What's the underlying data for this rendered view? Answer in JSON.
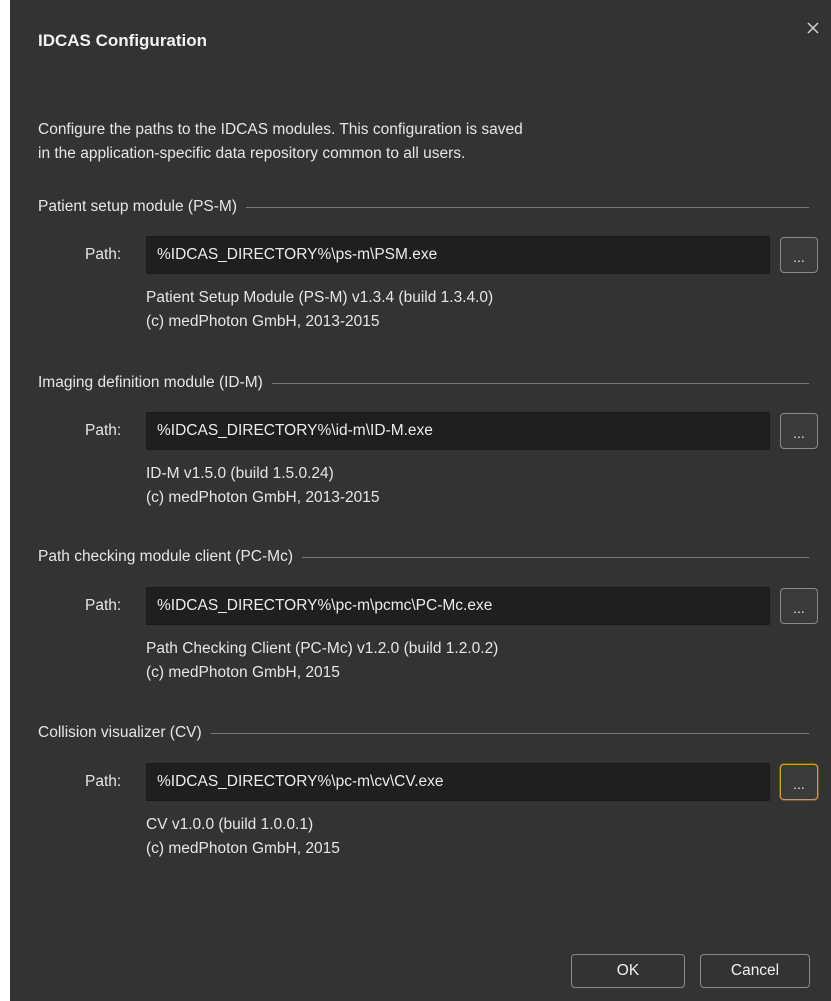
{
  "dialog": {
    "title": "IDCAS Configuration",
    "close_icon": "close-icon",
    "close_glyph": "×",
    "description_line1": "Configure the paths to the IDCAS modules. This configuration is saved",
    "description_line2": "in the application-specific data repository common to all users."
  },
  "modules": [
    {
      "group_title": "Patient setup module (PS-M)",
      "path_label": "Path:",
      "path_value": "%IDCAS_DIRECTORY%\\ps-m\\PSM.exe",
      "browse_label": "...",
      "info_line1": "Patient Setup Module (PS-M) v1.3.4 (build 1.3.4.0)",
      "info_line2": "(c) medPhoton GmbH, 2013-2015"
    },
    {
      "group_title": "Imaging definition module (ID-M)",
      "path_label": "Path:",
      "path_value": "%IDCAS_DIRECTORY%\\id-m\\ID-M.exe",
      "browse_label": "...",
      "info_line1": "ID-M v1.5.0 (build 1.5.0.24)",
      "info_line2": "(c) medPhoton GmbH, 2013-2015"
    },
    {
      "group_title": "Path checking module client (PC-Mc)",
      "path_label": "Path:",
      "path_value": "%IDCAS_DIRECTORY%\\pc-m\\pcmc\\PC-Mc.exe",
      "browse_label": "...",
      "info_line1": "Path Checking Client (PC-Mc) v1.2.0 (build 1.2.0.2)",
      "info_line2": "(c) medPhoton GmbH, 2015"
    },
    {
      "group_title": "Collision visualizer (CV)",
      "path_label": "Path:",
      "path_value": "%IDCAS_DIRECTORY%\\pc-m\\cv\\CV.exe",
      "browse_label": "...",
      "info_line1": "CV v1.0.0 (build 1.0.0.1)",
      "info_line2": "(c) medPhoton GmbH, 2015"
    }
  ],
  "buttons": {
    "ok_label": "OK",
    "cancel_label": "Cancel"
  },
  "colors": {
    "background": "#333333",
    "input_background": "#1f1f1f",
    "text": "#e6e6e6",
    "focus_accent": "#d99a3a"
  }
}
